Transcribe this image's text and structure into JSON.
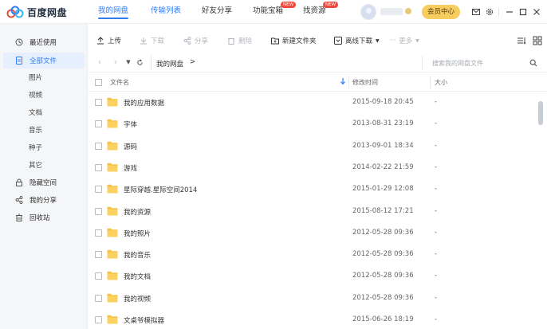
{
  "app": {
    "name": "百度网盘"
  },
  "nav": {
    "tabs": [
      {
        "label": "我的网盘"
      },
      {
        "label": "传输列表"
      },
      {
        "label": "好友分享"
      },
      {
        "label": "功能宝箱",
        "badge": "NEW"
      },
      {
        "label": "找资源",
        "badge": "NEW"
      }
    ],
    "member_button": "会员中心"
  },
  "sidebar": {
    "items": [
      {
        "label": "最近使用",
        "icon": "clock-icon"
      },
      {
        "label": "全部文件",
        "icon": "file-icon"
      },
      {
        "label": "隐藏空间",
        "icon": "lock-icon"
      },
      {
        "label": "我的分享",
        "icon": "share-icon"
      },
      {
        "label": "回收站",
        "icon": "trash-icon"
      }
    ],
    "subitems": [
      "图片",
      "视频",
      "文档",
      "音乐",
      "种子",
      "其它"
    ]
  },
  "toolbar": {
    "upload": "上传",
    "download": "下载",
    "share": "分享",
    "delete": "删除",
    "new_folder": "新建文件夹",
    "offline_download": "离线下载",
    "more": "更多"
  },
  "path": {
    "root": "我的网盘",
    "separator": ">"
  },
  "search": {
    "placeholder": "搜索我的网盘文件"
  },
  "columns": {
    "name": "文件名",
    "modified": "修改时间",
    "size": "大小"
  },
  "files": [
    {
      "name": "我的应用数据",
      "modified": "2015-09-18 20:45",
      "size": "-"
    },
    {
      "name": "字体",
      "modified": "2013-08-31 23:19",
      "size": "-"
    },
    {
      "name": "源码",
      "modified": "2013-09-01 18:34",
      "size": "-"
    },
    {
      "name": "游戏",
      "modified": "2014-02-22 21:59",
      "size": "-"
    },
    {
      "name": "星际穿越.星际空间2014",
      "modified": "2015-01-29 12:08",
      "size": "-"
    },
    {
      "name": "我的资源",
      "modified": "2015-08-12 17:21",
      "size": "-"
    },
    {
      "name": "我的照片",
      "modified": "2012-05-28 09:36",
      "size": "-"
    },
    {
      "name": "我的音乐",
      "modified": "2012-05-28 09:36",
      "size": "-"
    },
    {
      "name": "我的文档",
      "modified": "2012-05-28 09:36",
      "size": "-"
    },
    {
      "name": "我的视频",
      "modified": "2012-05-28 09:36",
      "size": "-"
    },
    {
      "name": "文桌爷模拟器",
      "modified": "2015-06-26 18:19",
      "size": "-"
    }
  ],
  "colors": {
    "accent": "#2f7cf6",
    "folder": "#f7c244",
    "member": "#f6cd5e",
    "badge": "#f04a3e"
  }
}
